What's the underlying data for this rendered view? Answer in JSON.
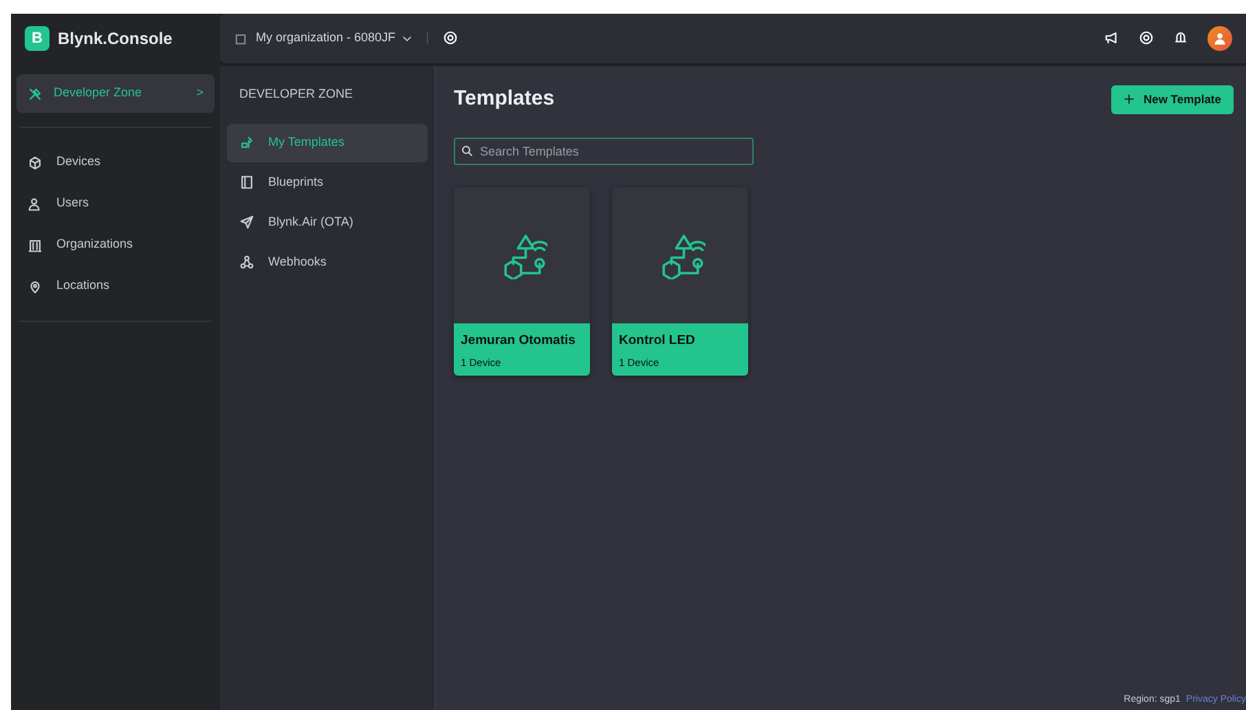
{
  "brand": {
    "logo": "B",
    "name": "Blynk.Console"
  },
  "sidebar": {
    "zone": {
      "label": "Developer Zone",
      "selected": true,
      "chevron": ">"
    },
    "items": [
      {
        "label": "Devices"
      },
      {
        "label": "Users"
      },
      {
        "label": "Organizations"
      },
      {
        "label": "Locations"
      }
    ]
  },
  "topbar": {
    "organization": "My organization - 6080JF",
    "separator": "|"
  },
  "subnav": {
    "heading": "DEVELOPER ZONE",
    "items": [
      {
        "label": "My Templates",
        "selected": true
      },
      {
        "label": "Blueprints",
        "selected": false
      },
      {
        "label": "Blynk.Air (OTA)",
        "selected": false
      },
      {
        "label": "Webhooks",
        "selected": false
      }
    ]
  },
  "main": {
    "title": "Templates",
    "new_button": "New Template",
    "search": {
      "placeholder": "Search Templates"
    },
    "templates": [
      {
        "name": "Jemuran Otomatis",
        "devices": "1 Device"
      },
      {
        "name": "Kontrol LED",
        "devices": "1 Device"
      }
    ]
  },
  "footer": {
    "region": "Region: sgp1",
    "privacy": "Privacy Policy"
  }
}
